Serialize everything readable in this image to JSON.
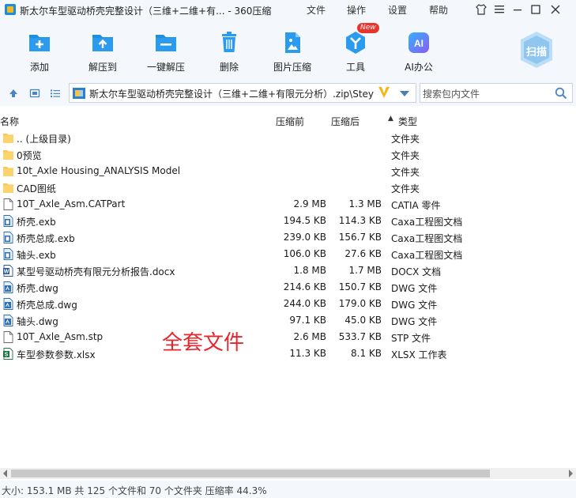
{
  "window": {
    "title": "斯太尔车型驱动桥壳完整设计（三维+二维+有... - 360压缩",
    "menus": [
      "文件",
      "操作",
      "设置",
      "帮助"
    ]
  },
  "toolbar": {
    "items": [
      {
        "label": "添加",
        "icon": "add-icon"
      },
      {
        "label": "解压到",
        "icon": "extract-to-icon"
      },
      {
        "label": "一键解压",
        "icon": "one-click-extract-icon"
      },
      {
        "label": "删除",
        "icon": "delete-icon"
      },
      {
        "label": "图片压缩",
        "icon": "image-compress-icon"
      },
      {
        "label": "工具",
        "icon": "tools-icon"
      },
      {
        "label": "AI办公",
        "icon": "ai-office-icon"
      }
    ],
    "new_badge": "New",
    "ai_glyph": "AI",
    "scan_label": "扫描"
  },
  "address": {
    "path": "斯太尔车型驱动桥壳完整设计（三维+二维+有限元分析）.zip\\Steyr A",
    "search_placeholder": "搜索包内文件"
  },
  "columns": {
    "name": "名称",
    "size": "压缩前",
    "compressed": "压缩后",
    "type": "类型"
  },
  "files": [
    {
      "name": ".. (上级目录)",
      "size": "",
      "compressed": "",
      "type": "文件夹",
      "kind": "folder"
    },
    {
      "name": "0预览",
      "size": "",
      "compressed": "",
      "type": "文件夹",
      "kind": "folder"
    },
    {
      "name": "10t_Axle Housing_ANALYSIS Model",
      "size": "",
      "compressed": "",
      "type": "文件夹",
      "kind": "folder"
    },
    {
      "name": "CAD图纸",
      "size": "",
      "compressed": "",
      "type": "文件夹",
      "kind": "folder"
    },
    {
      "name": "10T_Axle_Asm.CATPart",
      "size": "2.9 MB",
      "compressed": "1.3 MB",
      "type": "CATIA 零件",
      "kind": "generic"
    },
    {
      "name": "桥壳.exb",
      "size": "194.5 KB",
      "compressed": "114.3 KB",
      "type": "Caxa工程图文档",
      "kind": "caxa"
    },
    {
      "name": "桥壳总成.exb",
      "size": "239.0 KB",
      "compressed": "156.7 KB",
      "type": "Caxa工程图文档",
      "kind": "caxa"
    },
    {
      "name": "轴头.exb",
      "size": "106.0 KB",
      "compressed": "27.6 KB",
      "type": "Caxa工程图文档",
      "kind": "caxa"
    },
    {
      "name": "某型号驱动桥壳有限元分析报告.docx",
      "size": "1.8 MB",
      "compressed": "1.7 MB",
      "type": "DOCX 文档",
      "kind": "word"
    },
    {
      "name": "桥壳.dwg",
      "size": "214.6 KB",
      "compressed": "150.7 KB",
      "type": "DWG 文件",
      "kind": "dwg"
    },
    {
      "name": "桥壳总成.dwg",
      "size": "244.0 KB",
      "compressed": "179.0 KB",
      "type": "DWG 文件",
      "kind": "dwg"
    },
    {
      "name": "轴头.dwg",
      "size": "97.1 KB",
      "compressed": "45.0 KB",
      "type": "DWG 文件",
      "kind": "dwg"
    },
    {
      "name": "10T_Axle_Asm.stp",
      "size": "2.6 MB",
      "compressed": "533.7 KB",
      "type": "STP 文件",
      "kind": "generic"
    },
    {
      "name": "车型参数参数.xlsx",
      "size": "11.3 KB",
      "compressed": "8.1 KB",
      "type": "XLSX 工作表",
      "kind": "excel"
    }
  ],
  "annotation": "全套文件",
  "status": "大小: 153.1 MB 共 125 个文件和 70 个文件夹 压缩率 44.3%"
}
